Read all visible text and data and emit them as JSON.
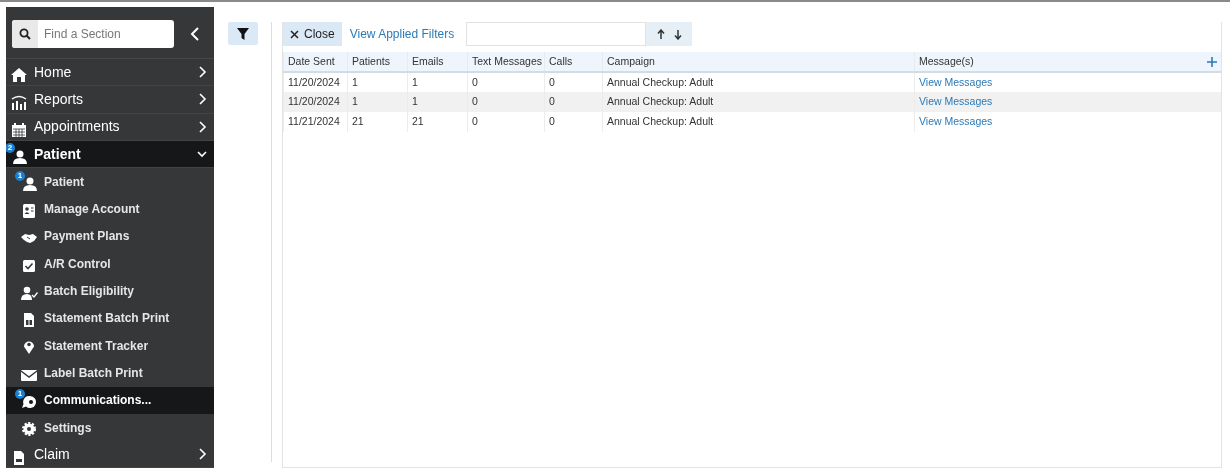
{
  "sidebar": {
    "search": {
      "placeholder": "Find a Section"
    },
    "sections": [
      {
        "label": "Home",
        "expanded": false,
        "selected": false
      },
      {
        "label": "Reports",
        "expanded": false,
        "selected": false
      },
      {
        "label": "Appointments",
        "expanded": false,
        "selected": false
      },
      {
        "label": "Patient",
        "expanded": true,
        "selected": true,
        "badge": "2",
        "children": [
          {
            "label": "Patient",
            "selected": false,
            "badge": "1"
          },
          {
            "label": "Manage Account",
            "selected": false
          },
          {
            "label": "Payment Plans",
            "selected": false
          },
          {
            "label": "A/R Control",
            "selected": false
          },
          {
            "label": "Batch Eligibility",
            "selected": false
          },
          {
            "label": "Statement Batch Print",
            "selected": false
          },
          {
            "label": "Statement Tracker",
            "selected": false
          },
          {
            "label": "Label Batch Print",
            "selected": false
          },
          {
            "label": "Communications...",
            "selected": true,
            "badge": "1"
          },
          {
            "label": "Settings",
            "selected": false
          }
        ]
      },
      {
        "label": "Claim",
        "expanded": false,
        "selected": false
      }
    ]
  },
  "toolbar": {
    "close_button": "Close",
    "applied_filters_link": "View Applied Filters"
  },
  "table": {
    "columns": [
      "Date Sent",
      "Patients",
      "Emails",
      "Text Messages",
      "Calls",
      "Campaign",
      "Message(s)"
    ],
    "rows": [
      [
        "11/20/2024",
        "1",
        "1",
        "0",
        "0",
        "Annual Checkup: Adult",
        "View Messages"
      ],
      [
        "11/20/2024",
        "1",
        "1",
        "0",
        "0",
        "Annual Checkup: Adult",
        "View Messages"
      ],
      [
        "11/21/2024",
        "21",
        "21",
        "0",
        "0",
        "Annual Checkup: Adult",
        "View Messages"
      ]
    ]
  }
}
